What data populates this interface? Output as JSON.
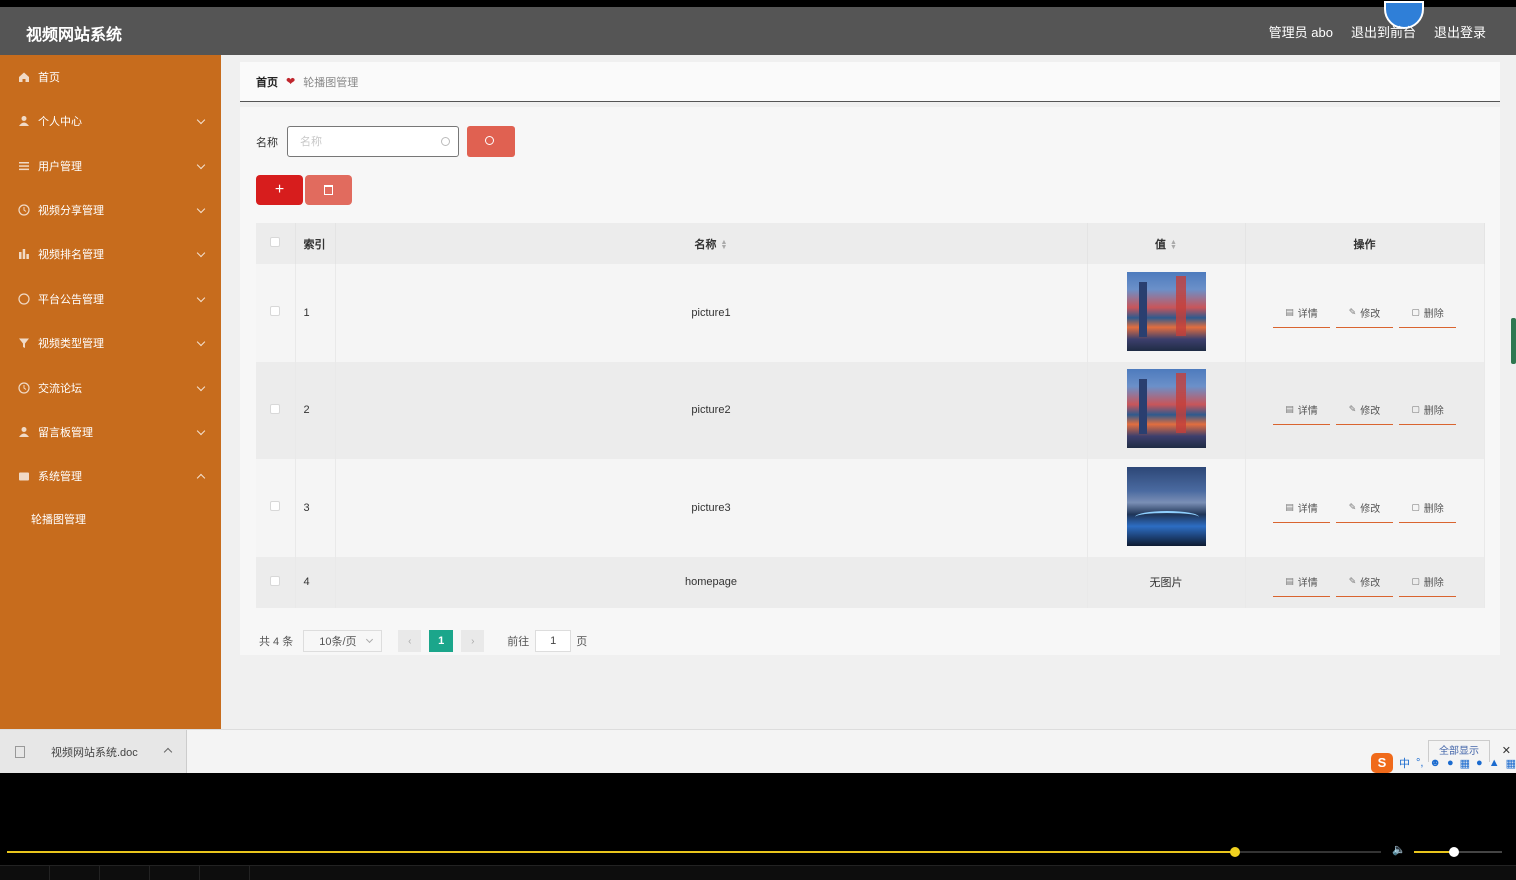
{
  "header": {
    "brand": "视频网站系统",
    "admin_label": "管理员 abo",
    "front_link": "退出到前台",
    "logout_link": "退出登录"
  },
  "sidebar": {
    "items": [
      {
        "label": "首页",
        "icon": "home-icon"
      },
      {
        "label": "个人中心",
        "icon": "user-icon"
      },
      {
        "label": "用户管理",
        "icon": "list-icon"
      },
      {
        "label": "视频分享管理",
        "icon": "clock-icon"
      },
      {
        "label": "视频排名管理",
        "icon": "bar-chart-icon"
      },
      {
        "label": "平台公告管理",
        "icon": "circle-icon"
      },
      {
        "label": "视频类型管理",
        "icon": "funnel-icon"
      },
      {
        "label": "交流论坛",
        "icon": "clock-icon"
      },
      {
        "label": "留言板管理",
        "icon": "user-icon"
      },
      {
        "label": "系统管理",
        "icon": "folder-icon"
      }
    ],
    "sub_items": [
      "轮播图管理"
    ]
  },
  "breadcrumb": {
    "home": "首页",
    "current": "轮播图管理"
  },
  "search": {
    "label": "名称",
    "placeholder": "名称",
    "value": ""
  },
  "table": {
    "headers": {
      "index": "索引",
      "name": "名称",
      "value": "值",
      "actions": "操作"
    },
    "rows": [
      {
        "index": "1",
        "name": "picture1",
        "value_type": "image",
        "value_text": ""
      },
      {
        "index": "2",
        "name": "picture2",
        "value_type": "image",
        "value_text": ""
      },
      {
        "index": "3",
        "name": "picture3",
        "value_type": "image",
        "value_text": ""
      },
      {
        "index": "4",
        "name": "homepage",
        "value_type": "text",
        "value_text": "无图片"
      }
    ],
    "action_labels": {
      "detail": "详情",
      "edit": "修改",
      "delete": "删除"
    }
  },
  "pagination": {
    "total": "共 4 条",
    "page_size": "10条/页",
    "current_page": "1",
    "goto_label": "前往",
    "goto_value": "1",
    "goto_unit": "页"
  },
  "downloads": {
    "file_name": "视频网站系统.doc",
    "show_all": "全部显示"
  },
  "ime": {
    "logo": "S",
    "lang": "中"
  },
  "player": {
    "progress": 0.894,
    "volume": 0.45
  },
  "colors": {
    "sidebar": "#c76c1d",
    "header": "#555555",
    "primary_red": "#d71d1d",
    "search_red": "#e06151",
    "pager_active": "#1ba68b",
    "progress": "#e8c51c"
  }
}
